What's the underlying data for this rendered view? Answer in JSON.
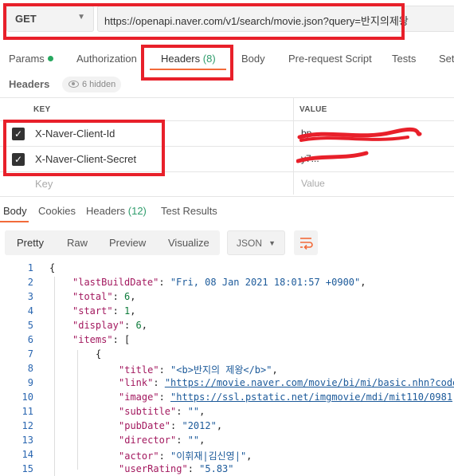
{
  "request": {
    "method": "GET",
    "url": "https://openapi.naver.com/v1/search/movie.json?query=반지의제왕"
  },
  "tabs": [
    {
      "label": "Params",
      "count": "",
      "dot": true
    },
    {
      "label": "Authorization",
      "count": ""
    },
    {
      "label": "Headers",
      "count": "(8)",
      "active": true
    },
    {
      "label": "Body",
      "count": ""
    },
    {
      "label": "Pre-request Script",
      "count": ""
    },
    {
      "label": "Tests",
      "count": ""
    },
    {
      "label": "Set",
      "count": ""
    }
  ],
  "headers_section": {
    "title": "Headers",
    "hidden": "6 hidden"
  },
  "table": {
    "col_key": "KEY",
    "col_value": "VALUE",
    "rows": [
      {
        "key": "X-Naver-Client-Id",
        "value": "bp...",
        "checked": true
      },
      {
        "key": "X-Naver-Client-Secret",
        "value": "y7...",
        "checked": true
      }
    ],
    "placeholder_key": "Key",
    "placeholder_value": "Value"
  },
  "response_tabs": [
    {
      "label": "Body",
      "count": "",
      "active": true
    },
    {
      "label": "Cookies",
      "count": ""
    },
    {
      "label": "Headers",
      "count": "(12)"
    },
    {
      "label": "Test Results",
      "count": ""
    }
  ],
  "toolbar": {
    "views": [
      "Pretty",
      "Raw",
      "Preview",
      "Visualize"
    ],
    "format": "JSON"
  },
  "code_lines": [
    {
      "n": "1",
      "text": "{"
    },
    {
      "n": "2",
      "key": "\"lastBuildDate\"",
      "val": "\"Fri, 08 Jan 2021 18:01:57 +0900\"",
      "type": "s",
      "indent": 1
    },
    {
      "n": "3",
      "key": "\"total\"",
      "val": "6",
      "type": "n",
      "indent": 1
    },
    {
      "n": "4",
      "key": "\"start\"",
      "val": "1",
      "type": "n",
      "indent": 1
    },
    {
      "n": "5",
      "key": "\"display\"",
      "val": "6",
      "type": "n",
      "indent": 1
    },
    {
      "n": "6",
      "key": "\"items\"",
      "val": "[",
      "type": "p",
      "indent": 1
    },
    {
      "n": "7",
      "text": "{",
      "indent": 2
    },
    {
      "n": "8",
      "key": "\"title\"",
      "val": "\"<b>반지의 제왕</b>\"",
      "type": "s",
      "indent": 3
    },
    {
      "n": "9",
      "key": "\"link\"",
      "val": "\"https://movie.naver.com/movie/bi/mi/basic.nhn?code",
      "type": "u",
      "indent": 3
    },
    {
      "n": "10",
      "key": "\"image\"",
      "val": "\"https://ssl.pstatic.net/imgmovie/mdi/mit110/0981",
      "type": "u",
      "indent": 3
    },
    {
      "n": "11",
      "key": "\"subtitle\"",
      "val": "\"\"",
      "type": "s",
      "indent": 3
    },
    {
      "n": "12",
      "key": "\"pubDate\"",
      "val": "\"2012\"",
      "type": "s",
      "indent": 3
    },
    {
      "n": "13",
      "key": "\"director\"",
      "val": "\"\"",
      "type": "s",
      "indent": 3
    },
    {
      "n": "14",
      "key": "\"actor\"",
      "val": "\"이휘재|김신영|\"",
      "type": "s",
      "indent": 3
    },
    {
      "n": "15",
      "key": "\"userRating\"",
      "val": "\"5.83\"",
      "type": "s",
      "indent": 3
    }
  ],
  "colors": {
    "accent": "#f26b3a",
    "highlight": "#e8202a",
    "count": "#2e9c6b"
  }
}
